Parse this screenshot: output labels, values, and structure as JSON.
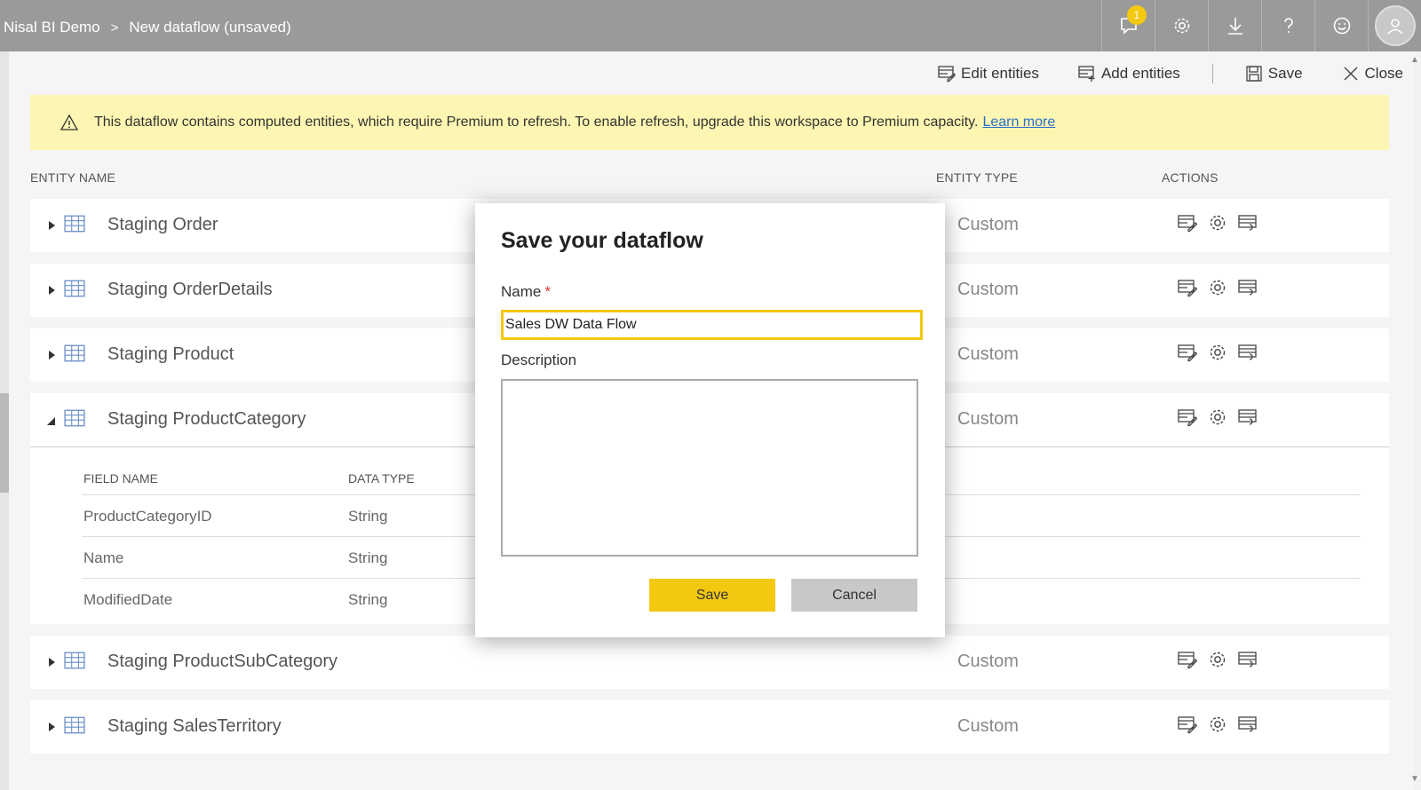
{
  "breadcrumb": {
    "workspace": "Nisal BI Demo",
    "separator": ">",
    "page": "New dataflow (unsaved)"
  },
  "topbar": {
    "notification_count": "1",
    "icons": [
      "notification-icon",
      "gear-icon",
      "download-icon",
      "help-icon",
      "smiley-icon",
      "avatar-icon"
    ]
  },
  "commands": {
    "edit_entities": "Edit entities",
    "add_entities": "Add entities",
    "save": "Save",
    "close": "Close"
  },
  "warning": {
    "text": "This dataflow contains computed entities, which require Premium to refresh. To enable refresh, upgrade this workspace to Premium capacity.",
    "link": "Learn more",
    "color": "#fdf6b2"
  },
  "table": {
    "headers": {
      "entity_name": "ENTITY NAME",
      "entity_type": "ENTITY TYPE",
      "actions": "ACTIONS"
    },
    "entities": [
      {
        "name": "Staging Order",
        "type": "Custom",
        "expanded": false
      },
      {
        "name": "Staging OrderDetails",
        "type": "Custom",
        "expanded": false
      },
      {
        "name": "Staging Product",
        "type": "Custom",
        "expanded": false
      },
      {
        "name": "Staging ProductCategory",
        "type": "Custom",
        "expanded": true
      },
      {
        "name": "Staging ProductSubCategory",
        "type": "Custom",
        "expanded": false
      },
      {
        "name": "Staging SalesTerritory",
        "type": "Custom",
        "expanded": false
      }
    ],
    "fields_headers": {
      "field_name": "FIELD NAME",
      "data_type": "DATA TYPE"
    },
    "fields": [
      {
        "name": "ProductCategoryID",
        "type": "String"
      },
      {
        "name": "Name",
        "type": "String"
      },
      {
        "name": "ModifiedDate",
        "type": "String"
      }
    ]
  },
  "modal": {
    "title": "Save your dataflow",
    "name_label": "Name",
    "required_mark": "*",
    "name_value": "Sales DW Data Flow",
    "description_label": "Description",
    "description_value": "",
    "save_label": "Save",
    "cancel_label": "Cancel"
  },
  "colors": {
    "accent": "#f2c811",
    "topbar": "#9a9a9a"
  }
}
